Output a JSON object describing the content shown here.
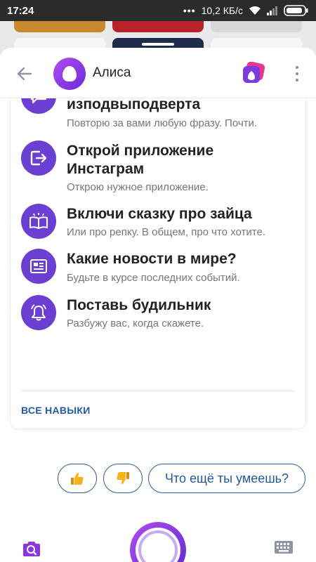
{
  "status_bar": {
    "time": "17:24",
    "network_speed": "10,2 КБ/с"
  },
  "header": {
    "title": "Алиса",
    "back_icon": "arrow-left-icon",
    "more_icon": "more-vertical-icon"
  },
  "skills": [
    {
      "title": "изподвыподверта",
      "description": "Повторю за вами любую фразу. Почти.",
      "icon": "chat-bubble-icon"
    },
    {
      "title": "Открой приложение Инстаграм",
      "description": "Открою нужное приложение.",
      "icon": "open-app-icon"
    },
    {
      "title": "Включи сказку про зайца",
      "description": "Или про репку. В общем, про что хотите.",
      "icon": "book-icon"
    },
    {
      "title": "Какие новости в мире?",
      "description": "Будьте в курсе последних событий.",
      "icon": "newspaper-icon"
    },
    {
      "title": "Поставь будильник",
      "description": "Разбужу вас, когда скажете.",
      "icon": "alarm-bell-icon"
    }
  ],
  "all_skills_label": "ВСЕ НАВЫКИ",
  "suggestions": {
    "like_icon": "thumbs-up-icon",
    "dislike_icon": "thumbs-down-icon",
    "more_question": "Что ещё ты умеешь?"
  },
  "colors": {
    "accent_purple": "#6b3fd1",
    "link_blue": "#235aa0",
    "thumb_yellow": "#f5b21b"
  }
}
